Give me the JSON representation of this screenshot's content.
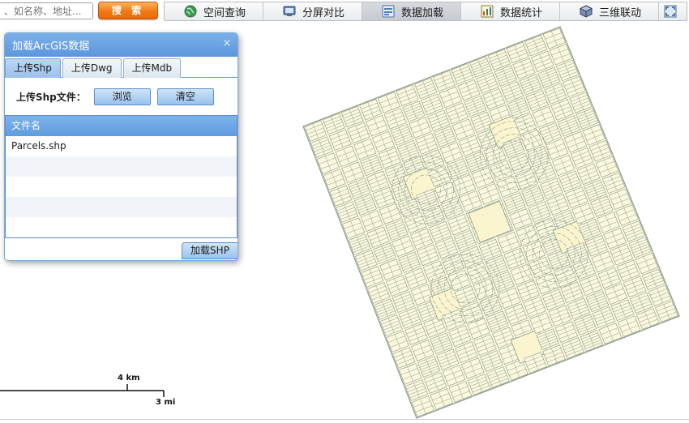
{
  "search": {
    "placeholder": "、如名称、地址...",
    "button_label": "搜 索"
  },
  "toolbar": {
    "items": [
      {
        "label": "空间查询",
        "icon": "globe-icon",
        "active": false
      },
      {
        "label": "分屏对比",
        "icon": "monitor-icon",
        "active": false
      },
      {
        "label": "数据加载",
        "icon": "data-load-icon",
        "active": true
      },
      {
        "label": "数据统计",
        "icon": "statistics-icon",
        "active": false
      },
      {
        "label": "三维联动",
        "icon": "cube-icon",
        "active": false
      },
      {
        "label": "",
        "icon": "fullscreen-icon",
        "active": false
      }
    ]
  },
  "panel": {
    "title": "加载ArcGIS数据",
    "close_symbol": "×",
    "tabs": [
      {
        "label": "上传Shp",
        "active": true
      },
      {
        "label": "上传Dwg",
        "active": false
      },
      {
        "label": "上传Mdb",
        "active": false
      }
    ],
    "upload_label": "上传Shp文件：",
    "browse_label": "浏览",
    "clear_label": "清空",
    "table": {
      "header": "文件名",
      "rows": [
        "Parcels.shp",
        "",
        "",
        "",
        ""
      ]
    },
    "load_button": "加载SHP"
  },
  "scale": {
    "metric": "4 km",
    "imperial": "3 mi"
  },
  "colors": {
    "parcel_fill": "#fbf8de",
    "parcel_stroke": "#8a9a8a",
    "accent_blue": "#5b97dc",
    "search_orange": "#f07a14"
  }
}
